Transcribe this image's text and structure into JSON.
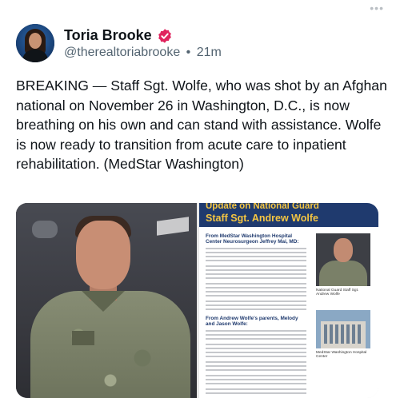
{
  "tweet": {
    "author": {
      "display_name": "Toria Brooke",
      "handle": "@therealtoriabrooke",
      "verified": true,
      "verified_color": "#e0245e"
    },
    "separator": "•",
    "time": "21m",
    "more_icon": "more-horizontal-icon",
    "text": "BREAKING — Staff Sgt. Wolfe, who was shot by an Afghan national on November 26 in Washington, D.C., is now breathing on his own and can stand with assistance. Wolfe is now ready to transition from acute care to inpatient rehabilitation. (MedStar Washington)",
    "media": {
      "document": {
        "banner_title": "Update on National Guard",
        "banner_subtitle": "Staff Sgt. Andrew Wolfe",
        "banner_color": "#1f3a6e",
        "banner_text_color": "#f4c542",
        "section_1": "From MedStar Washington Hospital Center Neurosurgeon Jeffrey Mai, MD:",
        "section_2": "From Andrew Wolfe's parents, Melody and Jason Wolfe:",
        "caption_1": "National Guard Staff Sgt. Andrew Wolfe",
        "caption_2": "MedStar Washington Hospital Center"
      }
    }
  }
}
